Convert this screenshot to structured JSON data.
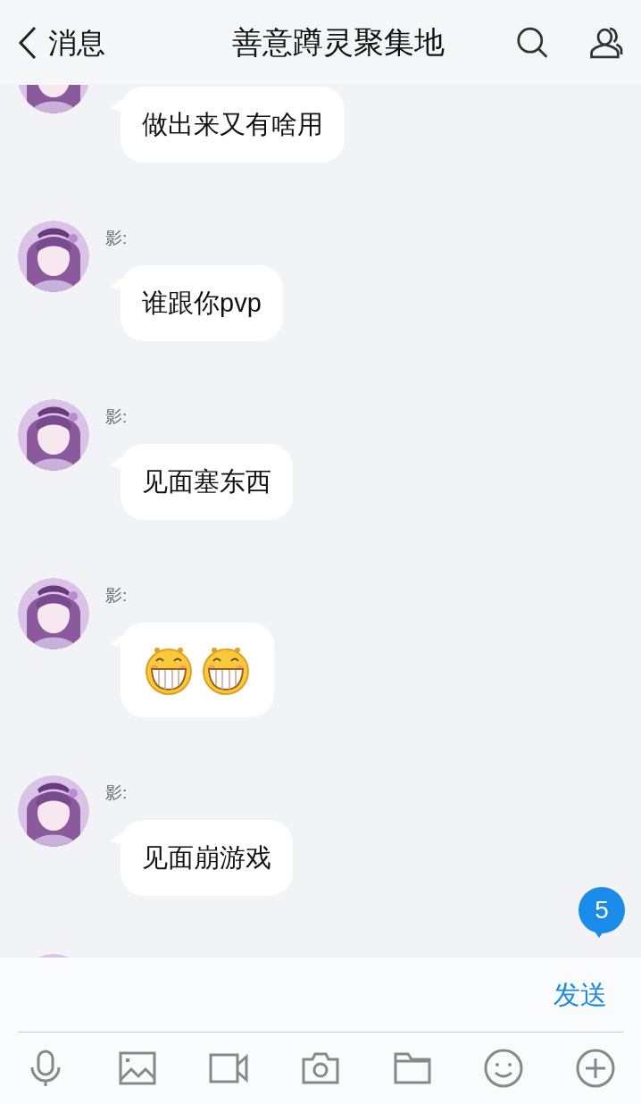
{
  "header": {
    "back_label": "消息",
    "title": "善意蹲灵聚集地"
  },
  "messages": [
    {
      "kind": "text",
      "text": "做出来又有啥用"
    },
    {
      "kind": "text",
      "sender": "影:",
      "text": "谁跟你pvp"
    },
    {
      "kind": "text",
      "sender": "影:",
      "text": "见面塞东西"
    },
    {
      "kind": "emoji",
      "sender": "影:"
    },
    {
      "kind": "text",
      "sender": "影:",
      "text": "见面崩游戏"
    },
    {
      "kind": "cut"
    }
  ],
  "unread_badge": "5",
  "composer": {
    "send_label": "发送"
  }
}
